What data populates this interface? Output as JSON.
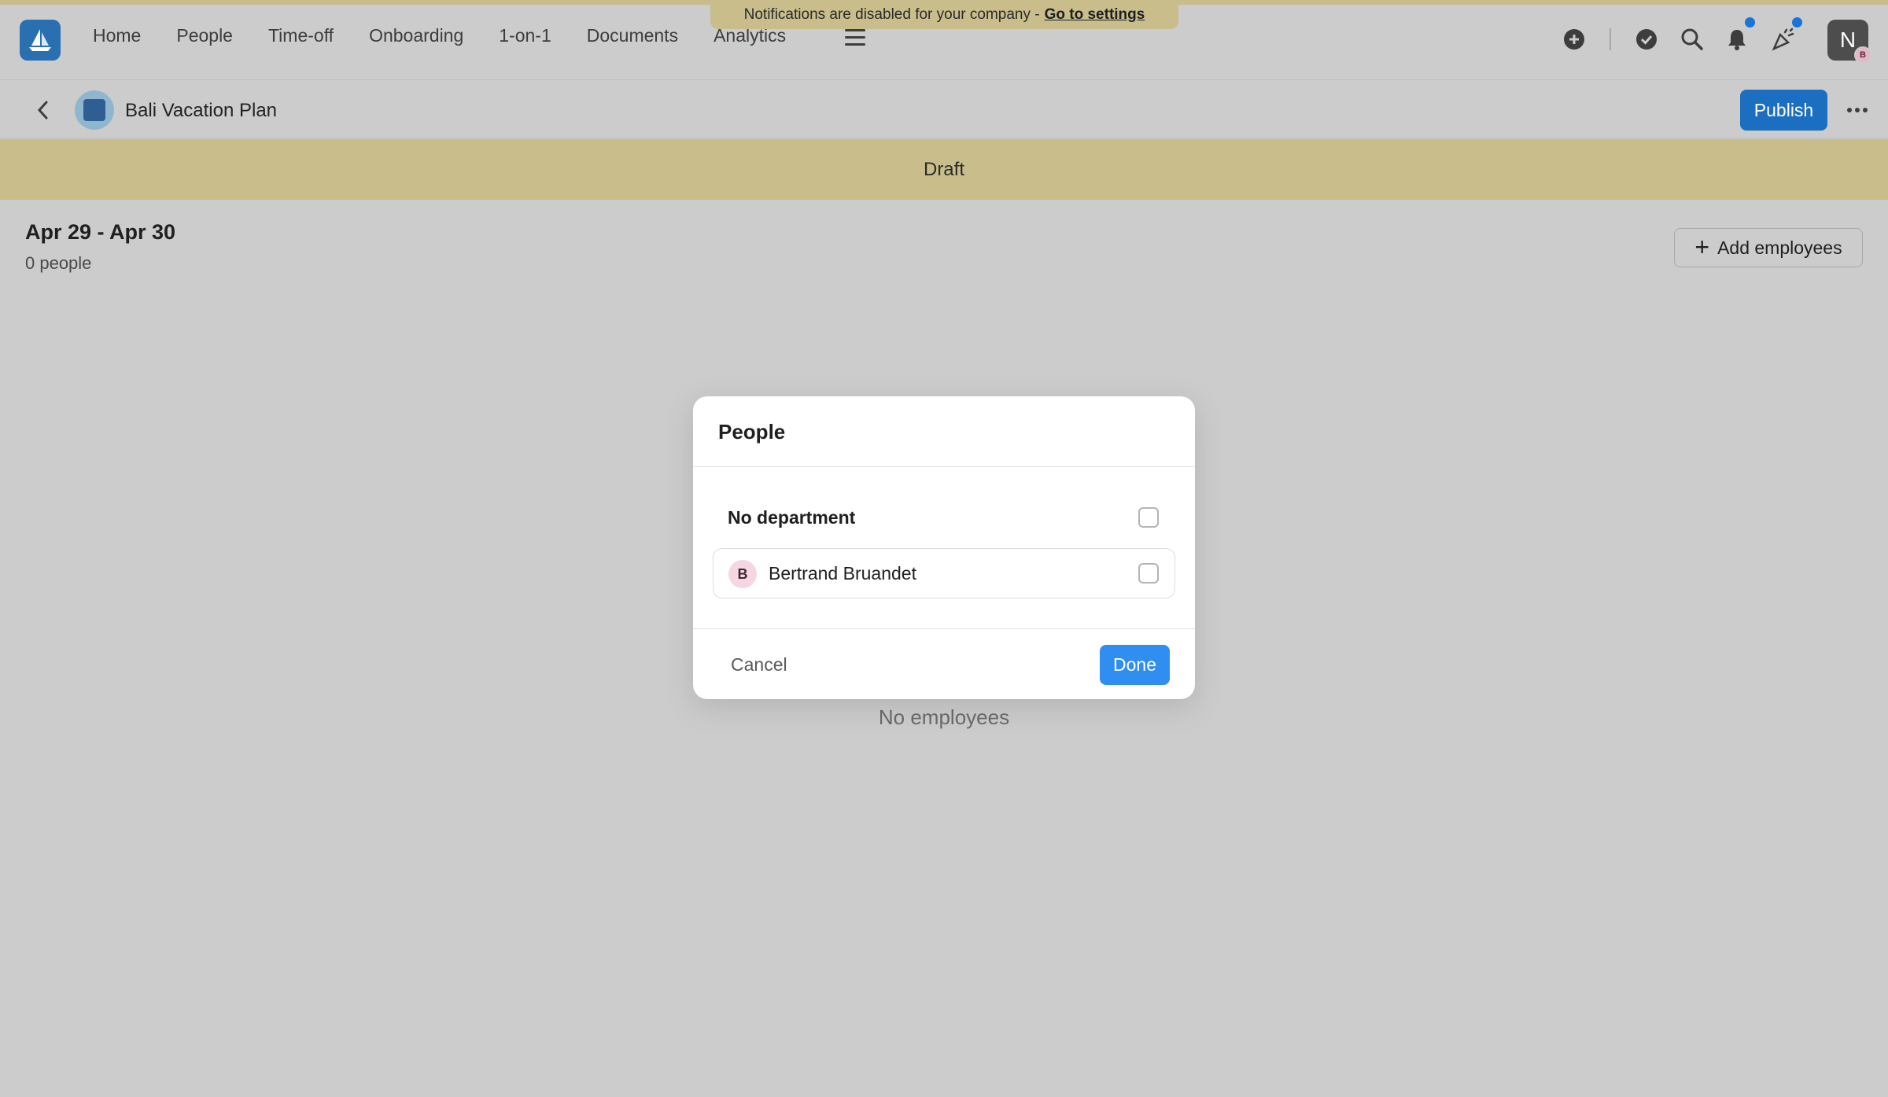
{
  "notification": {
    "text": "Notifications are disabled for your company -",
    "link": "Go to settings"
  },
  "nav": {
    "items": [
      "Home",
      "People",
      "Time-off",
      "Onboarding",
      "1-on-1",
      "Documents",
      "Analytics"
    ]
  },
  "user": {
    "initial": "N",
    "badge_initial": "B"
  },
  "plan": {
    "title": "Bali Vacation Plan",
    "publish_label": "Publish"
  },
  "status_banner": "Draft",
  "summary": {
    "date_range": "Apr 29 - Apr 30",
    "people_count": "0 people",
    "add_label": "Add employees"
  },
  "empty_state": "No employees",
  "modal": {
    "title": "People",
    "group_label": "No department",
    "person": {
      "initial": "B",
      "name": "Bertrand Bruandet"
    },
    "cancel_label": "Cancel",
    "done_label": "Done"
  },
  "colors": {
    "accent": "#2f8ef0",
    "banner": "#c8bd8b",
    "overlay": "#cccccc",
    "publish": "#1c6fc0"
  },
  "icons": [
    "add-circle-icon",
    "check-circle-icon",
    "search-icon",
    "bell-icon",
    "celebration-icon",
    "menu-icon",
    "chevron-left-icon",
    "more-icon",
    "plus-icon"
  ]
}
